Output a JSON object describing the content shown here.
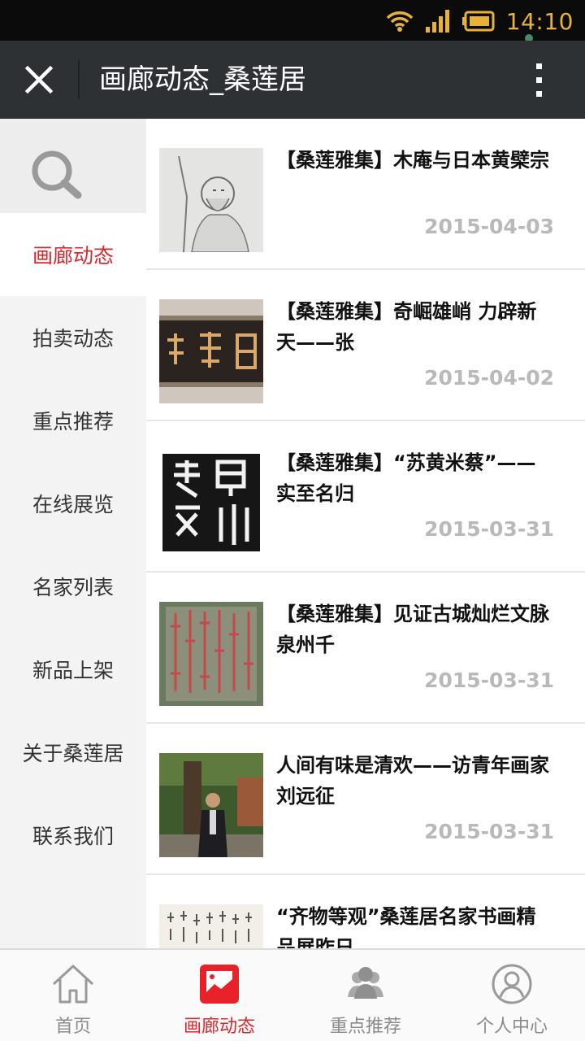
{
  "status_bar": {
    "time": "14:10",
    "icons": [
      "wifi-icon",
      "signal-icon",
      "battery-icon"
    ]
  },
  "title_bar": {
    "title": "画廊动态_桑莲居",
    "close_icon": "close-icon",
    "more_icon": "more-vertical-icon"
  },
  "sidebar": {
    "search_icon": "search-icon",
    "items": [
      {
        "label": "画廊动态",
        "active": true
      },
      {
        "label": "拍卖动态",
        "active": false
      },
      {
        "label": "重点推荐",
        "active": false
      },
      {
        "label": "在线展览",
        "active": false
      },
      {
        "label": "名家列表",
        "active": false
      },
      {
        "label": "新品上架",
        "active": false
      },
      {
        "label": "关于桑莲居",
        "active": false
      },
      {
        "label": "联系我们",
        "active": false
      }
    ]
  },
  "articles": [
    {
      "title": "【桑莲雅集】木庵与日本黄檗宗",
      "date": "2015-04-03",
      "thumb": "ink-portrait-image"
    },
    {
      "title": "【桑莲雅集】奇崛雄峭 力辟新天——张",
      "date": "2015-04-02",
      "thumb": "plaque-calligraphy-image"
    },
    {
      "title": "【桑莲雅集】“苏黄米蔡”——实至名归",
      "date": "2015-03-31",
      "thumb": "stele-rubbing-image"
    },
    {
      "title": "【桑莲雅集】见证古城灿烂文脉 泉州千",
      "date": "2015-03-31",
      "thumb": "red-stone-inscription-image"
    },
    {
      "title": "人间有味是清欢——访青年画家刘远征",
      "date": "2015-03-31",
      "thumb": "artist-photo-image"
    },
    {
      "title": "“齐物等观”桑莲居名家书画精品展昨日",
      "date": "",
      "thumb": "calligraphy-scroll-image"
    }
  ],
  "tabbar": {
    "tabs": [
      {
        "label": "首页",
        "icon": "home-icon",
        "active": false
      },
      {
        "label": "画廊动态",
        "icon": "gallery-icon",
        "active": true
      },
      {
        "label": "重点推荐",
        "icon": "people-icon",
        "active": false
      },
      {
        "label": "个人中心",
        "icon": "user-icon",
        "active": false
      }
    ]
  },
  "colors": {
    "accent": "#d9272e",
    "titlebar": "#2d3134",
    "statusbar": "#0b0b0b",
    "time": "#e8b23a",
    "date": "#b9b9b9"
  }
}
